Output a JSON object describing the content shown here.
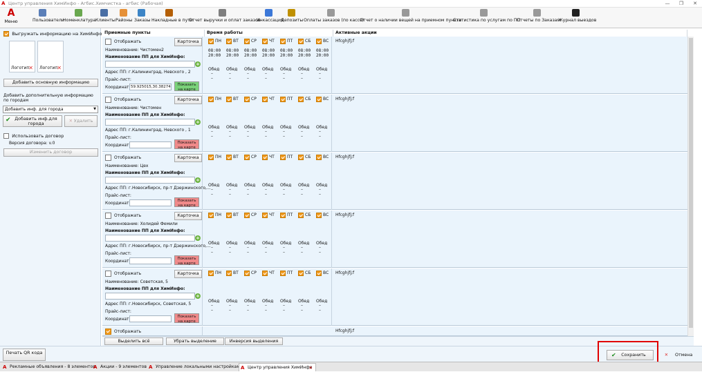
{
  "window": {
    "title": "Центр управления ХимИнфо - Агбис.Химчистка - агбис (Рабочая)",
    "min": "—",
    "max": "❐",
    "close": "✕"
  },
  "ribbon": {
    "menu_label": "Меню",
    "items": [
      {
        "label": "Пользователи",
        "icon": "users-icon",
        "color": "#5b7fb8"
      },
      {
        "label": "Номенклатура",
        "icon": "catalog-icon",
        "color": "#6aa84f"
      },
      {
        "label": "Клиенты",
        "icon": "client-icon",
        "color": "#4a6fa5"
      },
      {
        "label": "Районы",
        "icon": "district-icon",
        "color": "#e69138"
      },
      {
        "label": "Заказы",
        "icon": "orders-icon",
        "color": "#3d85c6"
      },
      {
        "label": "Накладные в пути",
        "icon": "truck-icon",
        "color": "#b45f06"
      },
      {
        "label": "Отчет выручки и оплат заказов",
        "icon": "revenue-report-icon",
        "color": "#7f7f7f"
      },
      {
        "label": "Инкассация",
        "icon": "cash-icon",
        "color": "#3c78d8"
      },
      {
        "label": "Депозиты",
        "icon": "deposit-icon",
        "color": "#bf9000"
      },
      {
        "label": "Оплаты заказов (по кассе)",
        "icon": "payment-icon",
        "color": "#999999"
      },
      {
        "label": "Отчет о наличии вещей на приемном пункте",
        "icon": "stock-report-icon",
        "color": "#999999"
      },
      {
        "label": "Статистика по услугам по ПП",
        "icon": "stats-icon",
        "color": "#999999"
      },
      {
        "label": "Отчеты по Заказам",
        "icon": "orders-report-icon",
        "color": "#999999"
      },
      {
        "label": "Журнал выездов",
        "icon": "journal-icon",
        "color": "#222222"
      }
    ]
  },
  "left": {
    "upload_label": "Выгружать информацию на ХимИнфо",
    "logo1": "Логотип",
    "logo2": "Логотип",
    "add_main_info": "Добавить основную информацию",
    "add_city_info_hint": "Добавить дополнительную информацию по городам",
    "city_select": "Добавить инф. для города",
    "add_city_btn": "Добавить инф.для города",
    "delete_btn": "Удалить",
    "use_contract": "Использовать договор",
    "contract_version": "Версия договора: v.0",
    "change_contract": "Изменить договор"
  },
  "grid": {
    "headers": {
      "points": "Приемные пункты",
      "hours": "Время работы",
      "promos": "Активные акции"
    },
    "labels": {
      "show": "Отображать",
      "card": "Карточка",
      "name_prefix": "Наименование: ",
      "pp_name_title": "Наименование ПП для ХимИнфо:",
      "address_prefix": "Адрес ПП: ",
      "price": "Прайс-лист:",
      "coords": "Координаты",
      "show_map": "Показать на карте",
      "lunch": "Обед",
      "dash": "–"
    },
    "days": [
      "ПН",
      "ВТ",
      "СР",
      "ЧТ",
      "ПТ",
      "СБ",
      "ВС"
    ],
    "rows": [
      {
        "name": "Чистомен2",
        "address": "г.Калининград, Невского , 2",
        "coords": "59.925015,30.382748",
        "open": "08:00",
        "close": "20:00",
        "promo": "Hfcghjfj;f",
        "map_color": "#7bd27a"
      },
      {
        "name": "Чистомен",
        "address": "г.Калининград, Невского , 1",
        "coords": "",
        "open": "",
        "close": "",
        "promo": "Hfcghjfj;f",
        "map_color": "#f08a8a"
      },
      {
        "name": "Цех",
        "address": "г.Новосибирск, пр-т Дзержинского,...",
        "coords": "",
        "open": "",
        "close": "",
        "promo": "Hfcghjfj;f",
        "map_color": "#f08a8a"
      },
      {
        "name": "Холидей Фемили",
        "address": "г.Новосибирск, пр-т Дзержинского,...",
        "coords": "",
        "open": "",
        "close": "",
        "promo": "Hfcghjfj;f",
        "map_color": "#f08a8a"
      },
      {
        "name": "Советская, 5",
        "address": "г.Новосибирск, Советская, 5",
        "coords": "",
        "open": "",
        "close": "",
        "promo": "Hfcghjfj;f",
        "map_color": "#f08a8a"
      }
    ],
    "partial_row": {
      "show": "Отображать",
      "promo": "Hfcghjfj;f"
    }
  },
  "bottom": {
    "select_all": "Выделить всё",
    "deselect": "Убрать выделение",
    "invert": "Инверсия выделения"
  },
  "footer": {
    "print_qr": "Печать QR кода",
    "save": "Сохранить",
    "cancel": "Отмена"
  },
  "tabs": [
    {
      "label": "Рекламные объявления - 8 элементов"
    },
    {
      "label": "Акции - 9 элементов"
    },
    {
      "label": "Управление локальными настройками"
    },
    {
      "label": "Центр управления ХимИнфо",
      "active": true,
      "close": "✕"
    }
  ]
}
